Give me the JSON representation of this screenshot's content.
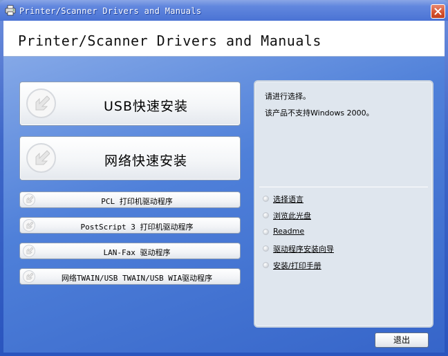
{
  "window": {
    "title": "Printer/Scanner Drivers and Manuals"
  },
  "header": {
    "title": "Printer/Scanner Drivers and Manuals"
  },
  "main_buttons": [
    {
      "label": "USB快速安装"
    },
    {
      "label": "网络快速安装"
    }
  ],
  "driver_buttons": [
    {
      "label": "PCL 打印机驱动程序"
    },
    {
      "label": "PostScript 3 打印机驱动程序"
    },
    {
      "label": "LAN-Fax 驱动程序"
    },
    {
      "label": "网络TWAIN/USB TWAIN/USB WIA驱动程序"
    }
  ],
  "info_panel": {
    "message_1": "请进行选择。",
    "message_2": "该产品不支持Windows 2000。",
    "links": [
      {
        "label": "选择语言"
      },
      {
        "label": "浏览此光盘"
      },
      {
        "label": "Readme"
      },
      {
        "label": "驱动程序安装向导"
      },
      {
        "label": "安装/打印手册"
      }
    ]
  },
  "footer": {
    "exit_label": "退出"
  },
  "icons": {
    "app": "printer-icon",
    "close": "close-icon",
    "install_arrow": "arrow-icon"
  },
  "colors": {
    "titlebar": "#4a73d4",
    "client_background": "#4f80d9",
    "panel_background": "#dfe6ee",
    "close_button": "#d4512e"
  }
}
